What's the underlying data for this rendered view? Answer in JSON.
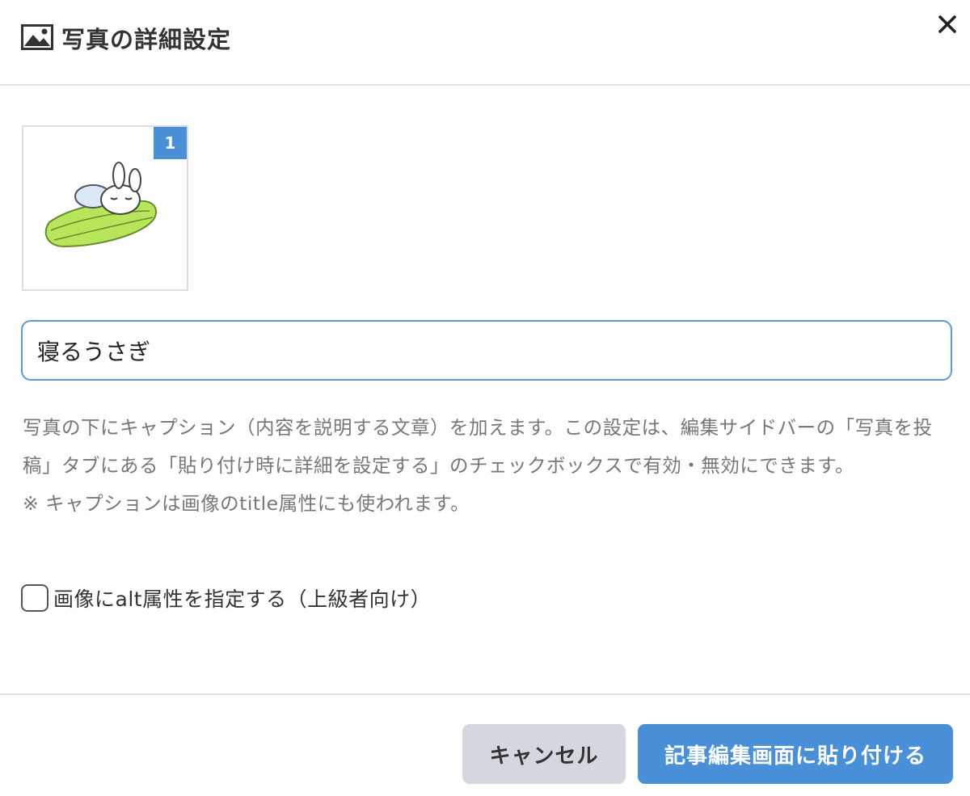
{
  "dialog": {
    "title": "写真の詳細設定",
    "header_icon": "image-icon",
    "close_icon": "close-icon"
  },
  "photo": {
    "badge": "1",
    "description_icon": "sleeping-rabbit-illustration"
  },
  "caption": {
    "value": "寝るうさぎ"
  },
  "help": {
    "text": "写真の下にキャプション（内容を説明する文章）を加えます。この設定は、編集サイドバーの「写真を投稿」タブにある「貼り付け時に詳細を設定する」のチェックボックスで有効・無効にできます。",
    "note": "※ キャプションは画像のtitle属性にも使われます。"
  },
  "alt_option": {
    "label": "画像にalt属性を指定する（上級者向け）",
    "checked": false
  },
  "footer": {
    "cancel_label": "キャンセル",
    "submit_label": "記事編集画面に貼り付ける"
  },
  "colors": {
    "accent": "#4a90d9",
    "cancel_bg": "#d4d7dd",
    "help_text": "#777777"
  }
}
